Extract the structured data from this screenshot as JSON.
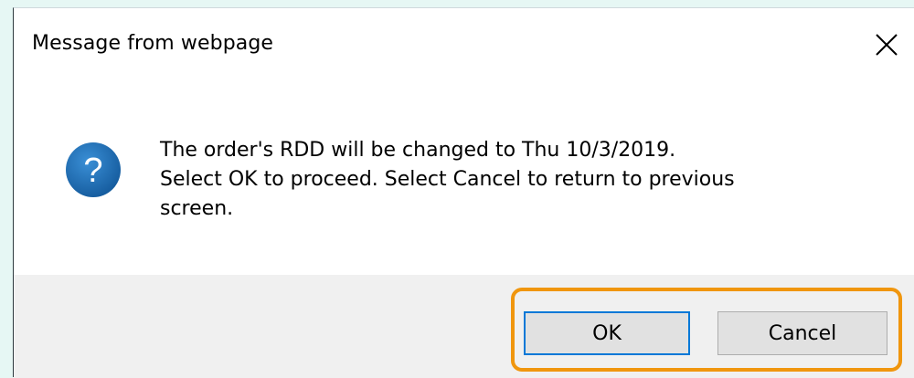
{
  "window": {
    "title": "Message from webpage"
  },
  "message": {
    "lines": [
      "The order's RDD will be changed to Thu 10/3/2019.",
      "Select OK to proceed.  Select Cancel to return to previous",
      "screen."
    ],
    "icon": "question-icon"
  },
  "buttons": {
    "ok_label": "OK",
    "cancel_label": "Cancel"
  },
  "colors": {
    "accent": "#0078d7",
    "highlight": "#f0960e",
    "icon_blue": "#1b6fb5",
    "button_bar": "#f0f0f0"
  }
}
